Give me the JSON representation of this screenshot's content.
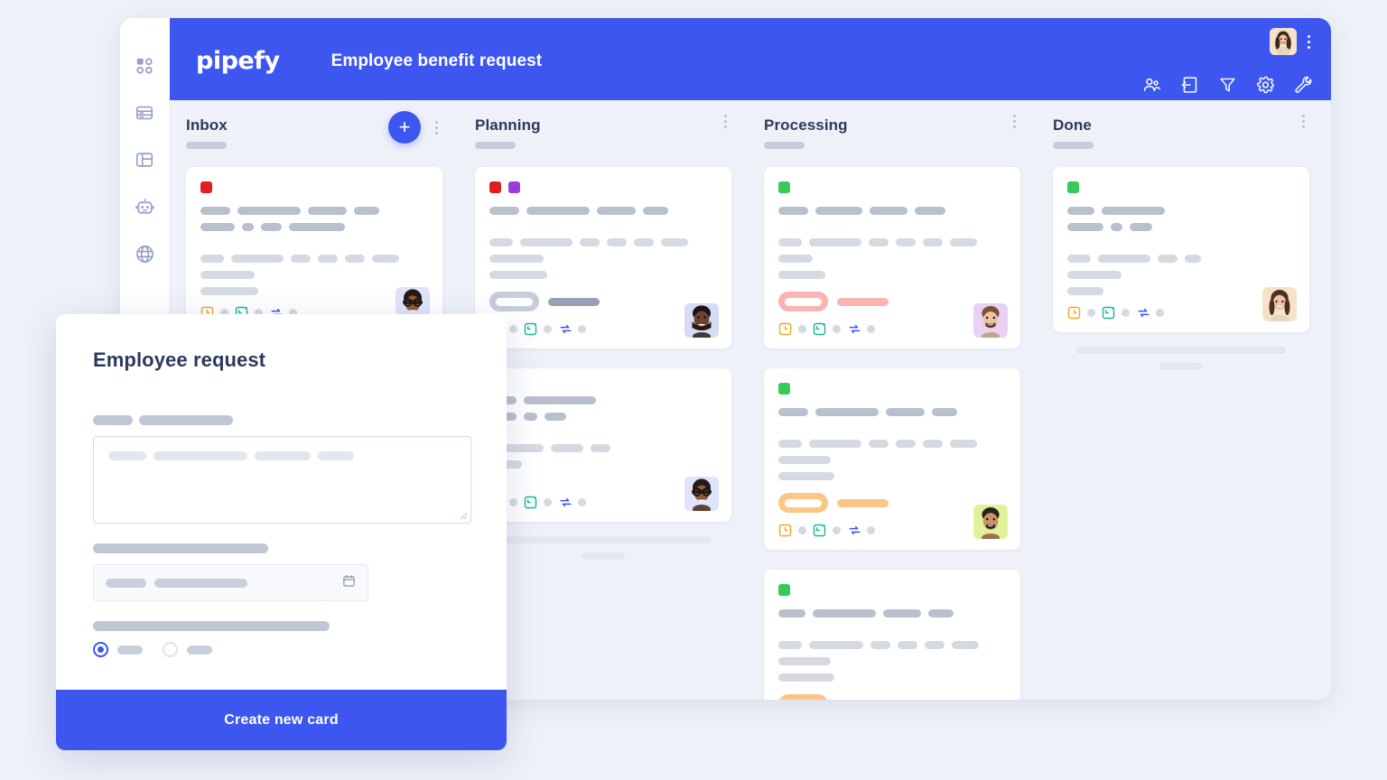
{
  "brand": {
    "logo_text": "pipefy",
    "accent": "#3d56f0"
  },
  "header": {
    "board_title": "Employee benefit request",
    "icons": [
      {
        "name": "members-icon",
        "label": "Members"
      },
      {
        "name": "import-icon",
        "label": "Import"
      },
      {
        "name": "filter-icon",
        "label": "Filter"
      },
      {
        "name": "settings-gear-icon",
        "label": "Settings"
      },
      {
        "name": "tools-wrench-icon",
        "label": "Automations"
      }
    ],
    "avatar_alt": "User avatar",
    "menu_label": "More options"
  },
  "sidebar": {
    "items": [
      {
        "name": "dashboard-icon",
        "label": "Dashboard"
      },
      {
        "name": "database-icon",
        "label": "Database"
      },
      {
        "name": "layout-icon",
        "label": "Layout"
      },
      {
        "name": "automation-robot-icon",
        "label": "Automations"
      },
      {
        "name": "globe-icon",
        "label": "Public"
      }
    ]
  },
  "board": {
    "add_card_label": "+",
    "columns": [
      {
        "id": "inbox",
        "title": "Inbox",
        "has_add_button": true
      },
      {
        "id": "planning",
        "title": "Planning",
        "has_add_button": false
      },
      {
        "id": "processing",
        "title": "Processing",
        "has_add_button": false
      },
      {
        "id": "done",
        "title": "Done",
        "has_add_button": false
      }
    ],
    "card_footer_icons": [
      {
        "name": "due-date-clock-icon",
        "color": "#f5a623"
      },
      {
        "name": "start-date-icon",
        "color": "#17b890"
      },
      {
        "name": "recurrence-sync-icon",
        "color": "#3d56f0"
      }
    ],
    "tag_colors": {
      "red": "#e02020",
      "purple": "#9b3ddb",
      "green": "#36ca58"
    },
    "pill_colors": {
      "gray": "#c6cddd",
      "pink": "#f9b3b3",
      "orange": "#fac884"
    },
    "avatar_backgrounds": [
      "#dfe4fb",
      "#d6dcf7",
      "#e8d1f5",
      "#dff29a",
      "#f6e2c8"
    ]
  },
  "modal": {
    "title": "Employee request",
    "submit_label": "Create new card",
    "calendar_icon": "calendar-icon",
    "radio_selected_index": 0,
    "radio_count": 2
  }
}
